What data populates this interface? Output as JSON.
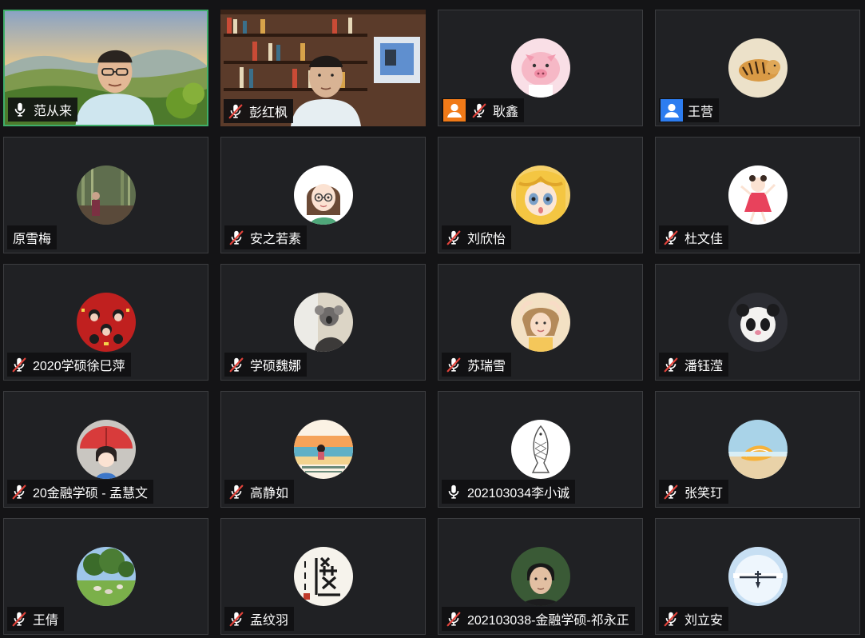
{
  "participants": [
    {
      "name": "范从来",
      "mic": "on",
      "avatar": "video-landscape-man",
      "active": true
    },
    {
      "name": "彭红枫",
      "mic": "muted",
      "avatar": "video-bookshelf-man"
    },
    {
      "name": "耿鑫",
      "mic": "muted",
      "avatar": "pig-cartoon",
      "user_icon": {
        "name": "default-user-icon",
        "color": "#f07a18"
      }
    },
    {
      "name": "王营",
      "mic": "none",
      "avatar": "tiger-painting",
      "user_icon": {
        "name": "default-user-icon",
        "color": "#2d7df0"
      }
    },
    {
      "name": "原雪梅",
      "mic": "none",
      "avatar": "bamboo-photo"
    },
    {
      "name": "安之若素",
      "mic": "muted",
      "avatar": "girl-glasses-cartoon"
    },
    {
      "name": "刘欣怡",
      "mic": "muted",
      "avatar": "blonde-anime-girl"
    },
    {
      "name": "杜文佳",
      "mic": "muted",
      "avatar": "dancing-girl-cartoon"
    },
    {
      "name": "2020学硕徐巳萍",
      "mic": "muted",
      "avatar": "red-festive-art"
    },
    {
      "name": "学硕魏娜",
      "mic": "muted",
      "avatar": "koala-photo"
    },
    {
      "name": "苏瑞雪",
      "mic": "muted",
      "avatar": "child-photo"
    },
    {
      "name": "潘钰滢",
      "mic": "muted",
      "avatar": "panda-plush"
    },
    {
      "name": "20金融学硕 - 孟慧文",
      "mic": "muted",
      "avatar": "umbrella-girl-cartoon"
    },
    {
      "name": "高静如",
      "mic": "muted",
      "avatar": "beach-painting"
    },
    {
      "name": "202103034李小诚",
      "mic": "on",
      "avatar": "fish-sketch"
    },
    {
      "name": "张笑玎",
      "mic": "muted",
      "avatar": "seashell-photo"
    },
    {
      "name": "王倩",
      "mic": "muted",
      "avatar": "park-geese-photo"
    },
    {
      "name": "孟纹羽",
      "mic": "muted",
      "avatar": "calligraphy-seal"
    },
    {
      "name": "202103038-金融学硕-祁永正",
      "mic": "muted",
      "avatar": "man-portrait"
    },
    {
      "name": "刘立安",
      "mic": "muted",
      "avatar": "airplane-photo"
    }
  ],
  "colors": {
    "background": "#141416",
    "tile": "#202124",
    "active_border": "#3fae6a",
    "mute_slash": "#e2433b"
  }
}
